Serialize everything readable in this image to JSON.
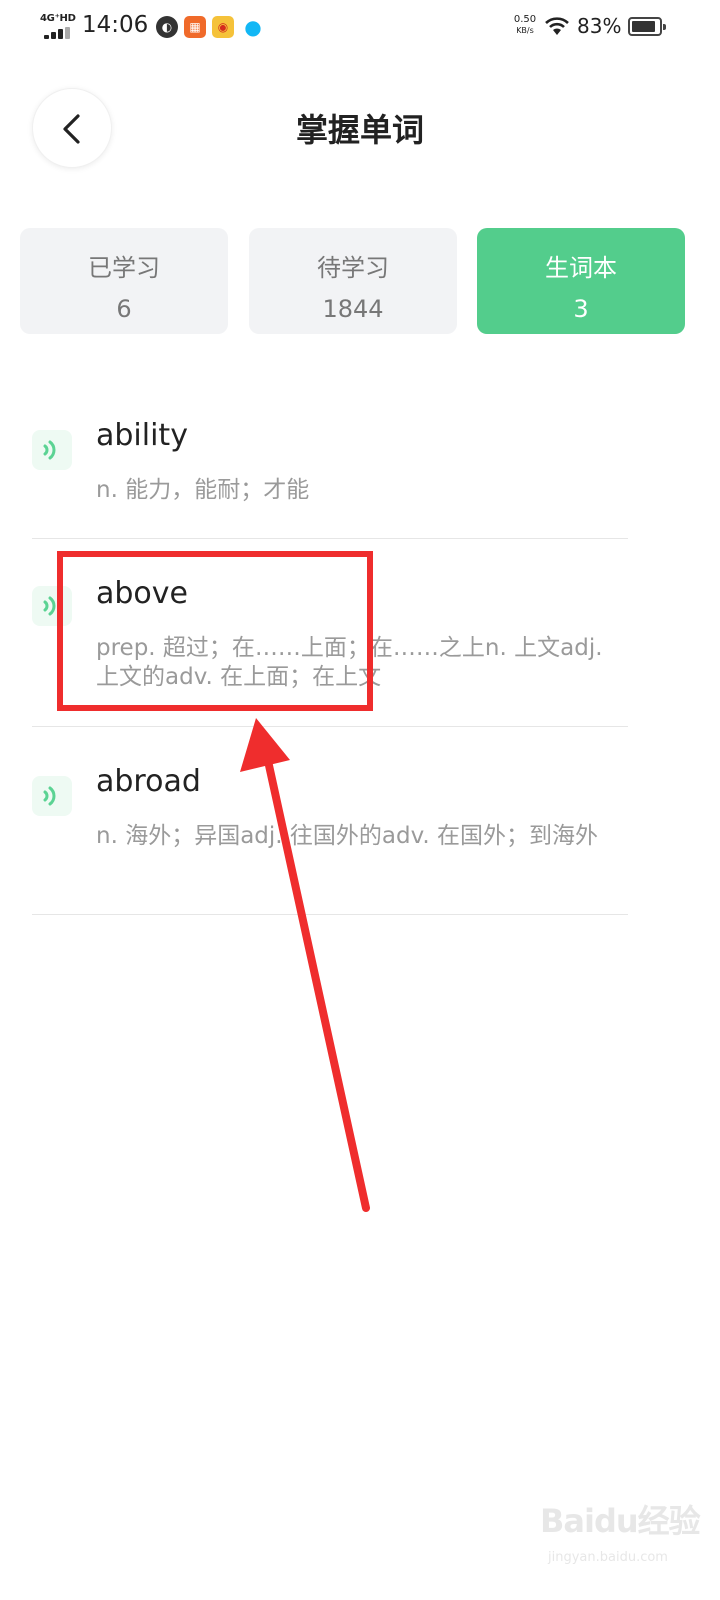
{
  "status_bar": {
    "network": "4G⁺HD",
    "time": "14:06",
    "speed_value": "0.50",
    "speed_unit": "KB/s",
    "battery": "83%"
  },
  "header": {
    "title": "掌握单词"
  },
  "tabs": [
    {
      "label": "已学习",
      "count": "6",
      "active": false
    },
    {
      "label": "待学习",
      "count": "1844",
      "active": false
    },
    {
      "label": "生词本",
      "count": "3",
      "active": true
    }
  ],
  "words": [
    {
      "word": "ability",
      "meaning": "n. 能力，能耐；才能"
    },
    {
      "word": "above",
      "meaning": "prep. 超过；在……上面；在……之上n. 上文adj. 上文的adv. 在上面；在上文"
    },
    {
      "word": "abroad",
      "meaning": "n. 海外；异国adj. 往国外的adv. 在国外；到海外"
    }
  ],
  "watermark": {
    "logo": "Baidu经验",
    "url": "jingyan.baidu.com"
  },
  "colors": {
    "accent": "#53cd8c",
    "annotation": "#ef2d2d"
  }
}
